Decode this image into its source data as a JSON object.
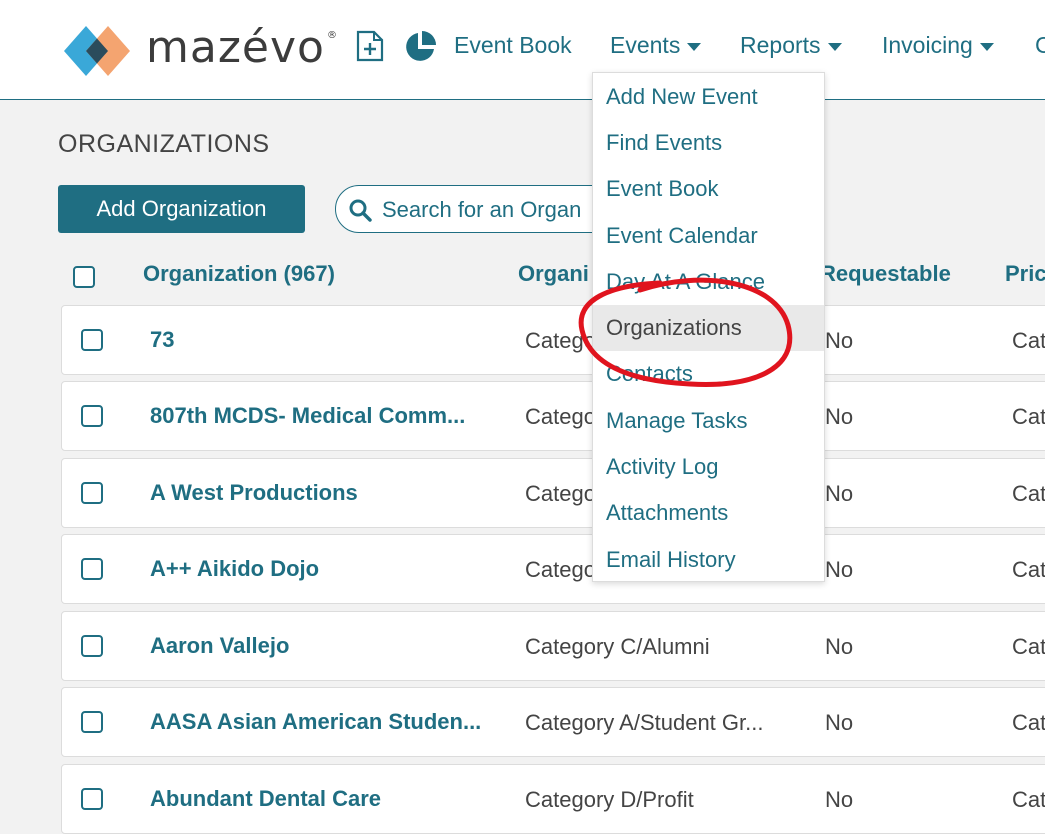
{
  "app": {
    "logo_text": "mazévo",
    "logo_mark": "®",
    "colors": {
      "accent": "#1f6e82",
      "logo_blue": "#3aa8d8",
      "logo_dark": "#2b4c5c",
      "logo_orange": "#f4a470",
      "annotation": "#e0141e"
    }
  },
  "nav": {
    "new_event_icon": "new-document-icon",
    "reports_icon": "pie-chart-icon",
    "event_book": "Event Book",
    "events": "Events",
    "reports": "Reports",
    "invoicing": "Invoicing",
    "overflow": "C"
  },
  "events_menu": {
    "items": [
      "Add New Event",
      "Find Events",
      "Event Book",
      "Event Calendar",
      "Day At A Glance",
      "Organizations",
      "Contacts",
      "Manage Tasks",
      "Activity Log",
      "Attachments",
      "Email History"
    ],
    "active": "Organizations"
  },
  "page": {
    "title": "ORGANIZATIONS",
    "add_button": "Add Organization",
    "search_placeholder": "Search for an Organ"
  },
  "table": {
    "headers": {
      "organization": "Organization (967)",
      "type": "Organi",
      "requestable": "Requestable",
      "priority": "Pric"
    },
    "rows": [
      {
        "name": "73",
        "category": "Catego",
        "requestable": "No",
        "priority": "Cat"
      },
      {
        "name": "807th MCDS- Medical Comm...",
        "category": "Catego",
        "requestable": "No",
        "priority": "Cat"
      },
      {
        "name": "A West Productions",
        "category": "Catego",
        "requestable": "No",
        "priority": "Cat"
      },
      {
        "name": "A++ Aikido Dojo",
        "category": "Catego",
        "requestable": "No",
        "priority": "Cat"
      },
      {
        "name": "Aaron Vallejo",
        "category": "Category C/Alumni",
        "requestable": "No",
        "priority": "Cat"
      },
      {
        "name": "AASA Asian American Studen...",
        "category": "Category A/Student Gr...",
        "requestable": "No",
        "priority": "Cat"
      },
      {
        "name": "Abundant Dental Care",
        "category": "Category D/Profit",
        "requestable": "No",
        "priority": "Cat"
      }
    ]
  }
}
